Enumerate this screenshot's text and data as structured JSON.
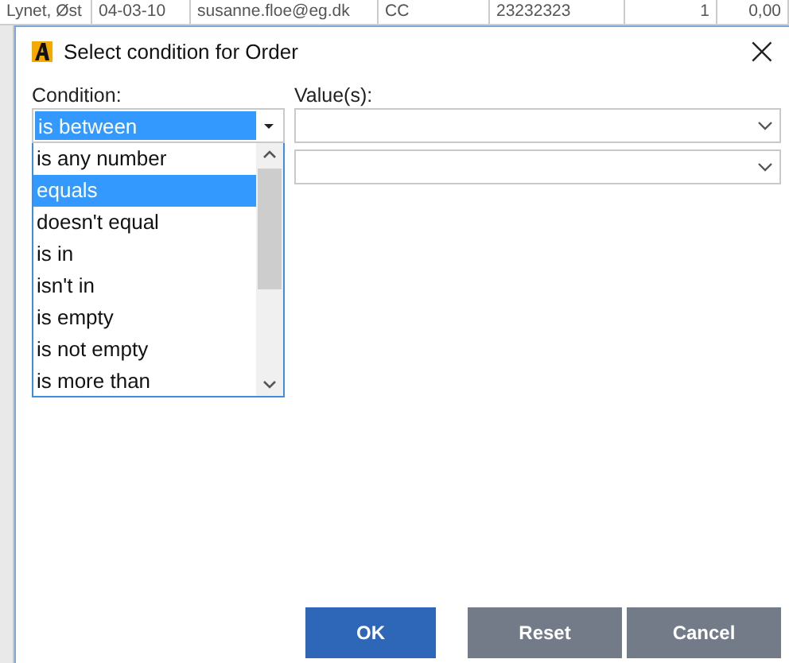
{
  "background_row": {
    "cells": [
      "Lynet, Øst",
      "04-03-10",
      "susanne.floe@eg.dk",
      "CC",
      "23232323",
      "1",
      "0,00"
    ]
  },
  "dialog": {
    "title": "Select condition for Order",
    "close": "×",
    "condition_label": "Condition:",
    "condition_value": "is between",
    "values_label": "Value(s):",
    "options": [
      {
        "label": "is any number",
        "selected": false
      },
      {
        "label": "equals",
        "selected": true
      },
      {
        "label": "doesn't equal",
        "selected": false
      },
      {
        "label": "is in",
        "selected": false
      },
      {
        "label": "isn't in",
        "selected": false
      },
      {
        "label": "is empty",
        "selected": false
      },
      {
        "label": "is not empty",
        "selected": false
      },
      {
        "label": "is more than",
        "selected": false
      }
    ],
    "buttons": [
      {
        "label": "OK",
        "kind": "primary"
      },
      {
        "label": "Reset",
        "kind": "secondary"
      },
      {
        "label": "Cancel",
        "kind": "secondary"
      }
    ]
  }
}
